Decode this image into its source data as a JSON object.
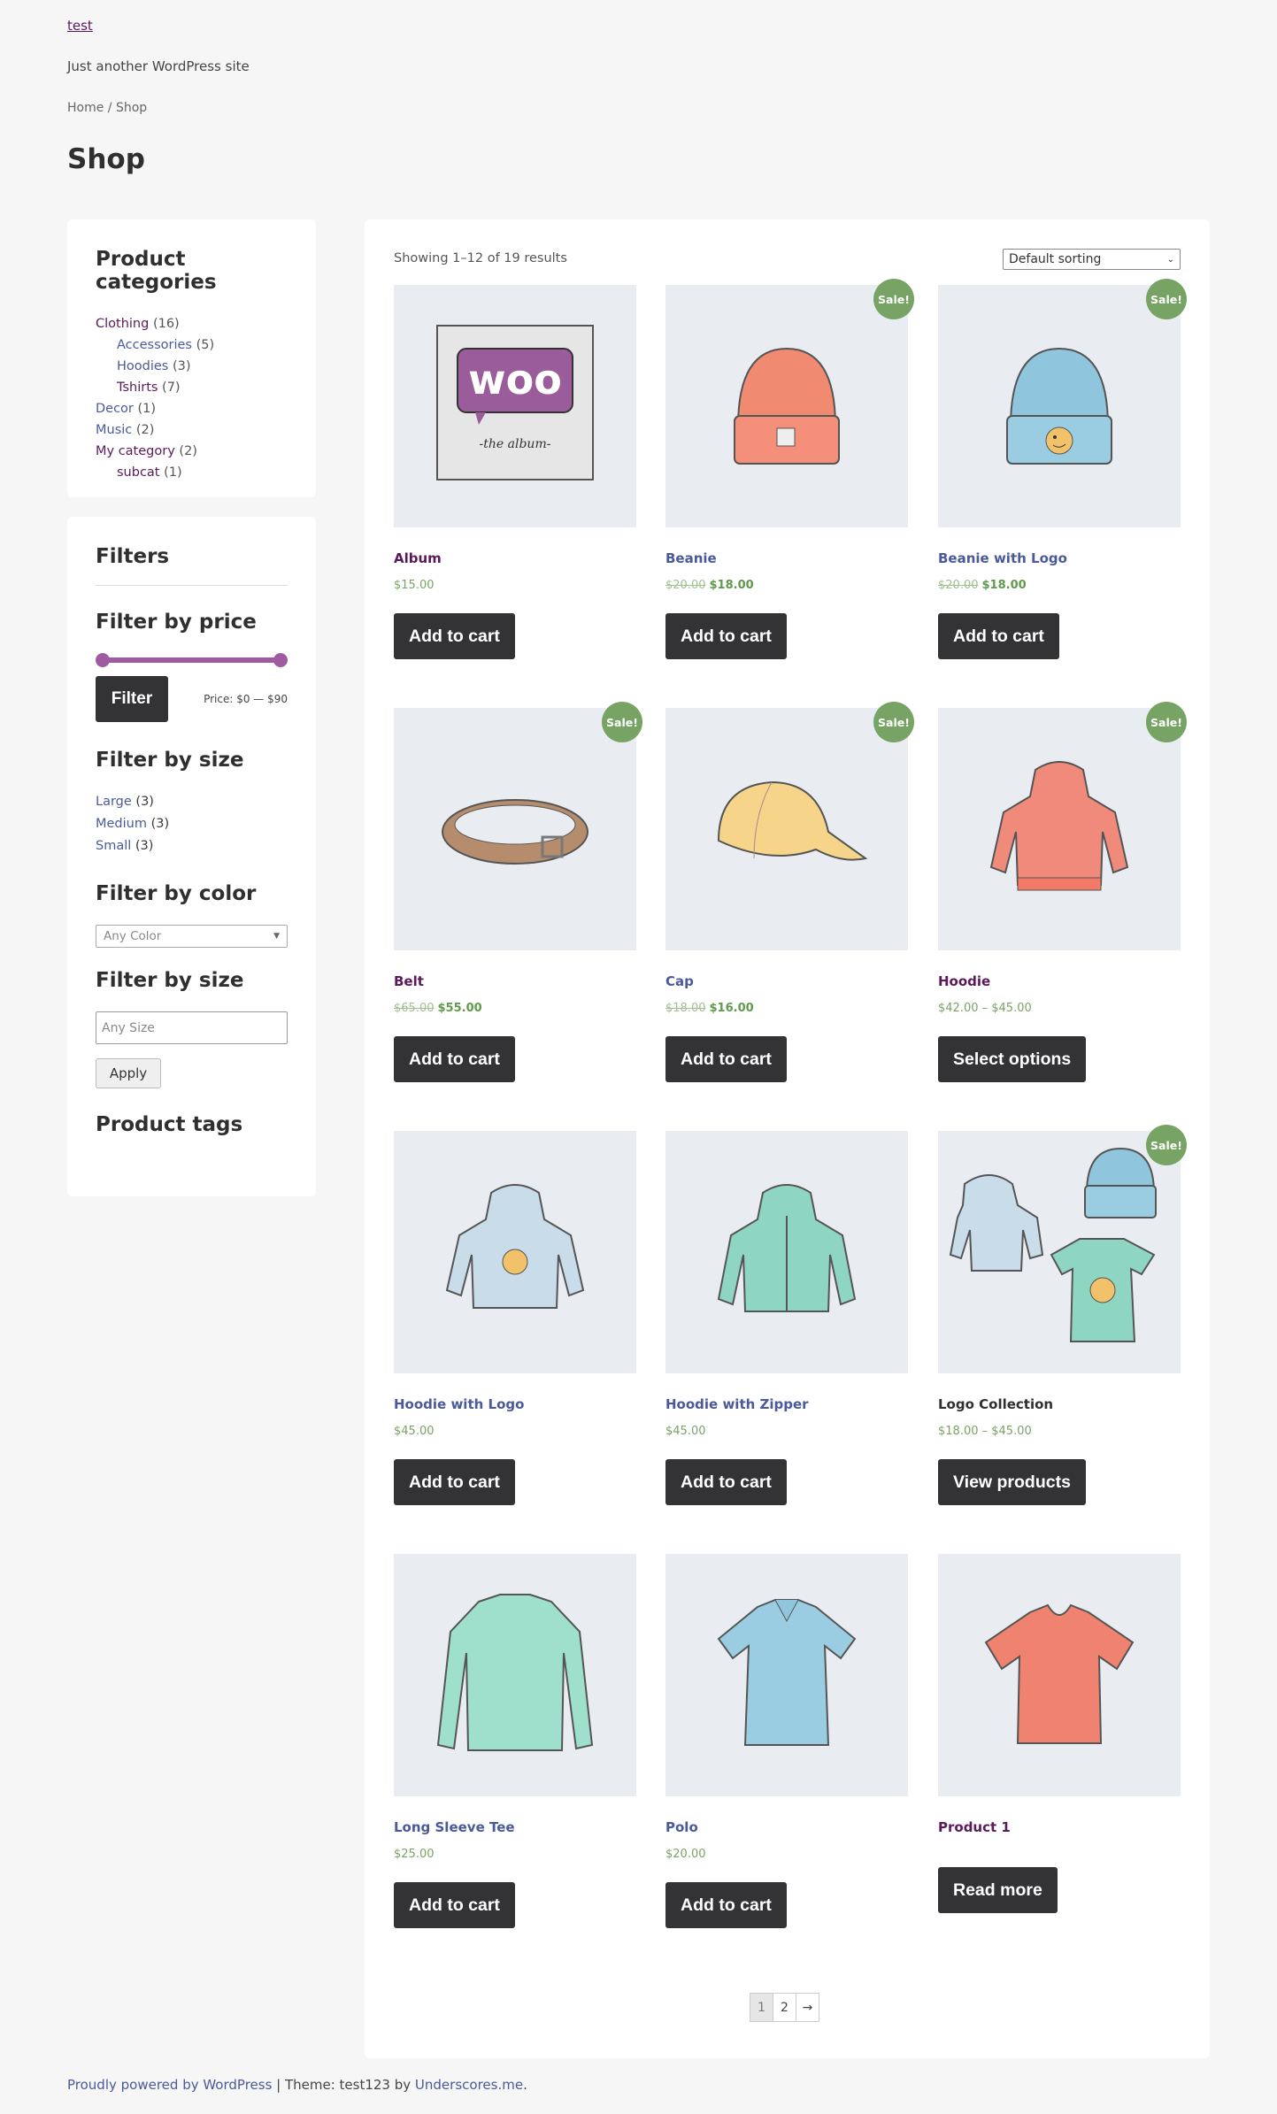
{
  "site": {
    "title": "test",
    "tagline": "Just another WordPress site"
  },
  "breadcrumb": {
    "home": "Home",
    "sep": " / ",
    "current": "Shop"
  },
  "page_title": "Shop",
  "categories": {
    "title": "Product categories",
    "items": [
      {
        "label": "Clothing",
        "count": "(16)"
      },
      {
        "label": "Accessories",
        "count": "(5)"
      },
      {
        "label": "Hoodies",
        "count": "(3)"
      },
      {
        "label": "Tshirts",
        "count": "(7)"
      },
      {
        "label": "Decor",
        "count": "(1)"
      },
      {
        "label": "Music",
        "count": "(2)"
      },
      {
        "label": "My category",
        "count": "(2)"
      },
      {
        "label": "subcat",
        "count": "(1)"
      }
    ]
  },
  "filters": {
    "title": "Filters",
    "price_title": "Filter by price",
    "filter_button": "Filter",
    "price_label": "Price: $0 — $90",
    "size_title": "Filter by size",
    "sizes": [
      {
        "label": "Large",
        "count": "(3)"
      },
      {
        "label": "Medium",
        "count": "(3)"
      },
      {
        "label": "Small",
        "count": "(3)"
      }
    ],
    "color_title": "Filter by color",
    "color_placeholder": "Any Color",
    "size_title_2": "Filter by size",
    "size_placeholder": "Any Size",
    "apply_button": "Apply",
    "tags_title": "Product tags"
  },
  "toolbar": {
    "result_count": "Showing 1–12 of 19 results",
    "sorting": "Default sorting"
  },
  "sale_badge": "Sale!",
  "products": [
    {
      "name": "Album",
      "price": "$15.00",
      "old_price": "",
      "new_price": "",
      "button": "Add to cart",
      "sale": false,
      "icon": "album-icon"
    },
    {
      "name": "Beanie",
      "price": "",
      "old_price": "$20.00",
      "new_price": "$18.00",
      "button": "Add to cart",
      "sale": true,
      "icon": "beanie-icon"
    },
    {
      "name": "Beanie with Logo",
      "price": "",
      "old_price": "$20.00",
      "new_price": "$18.00",
      "button": "Add to cart",
      "sale": true,
      "icon": "beanie-logo-icon"
    },
    {
      "name": "Belt",
      "price": "",
      "old_price": "$65.00",
      "new_price": "$55.00",
      "button": "Add to cart",
      "sale": true,
      "icon": "belt-icon"
    },
    {
      "name": "Cap",
      "price": "",
      "old_price": "$18.00",
      "new_price": "$16.00",
      "button": "Add to cart",
      "sale": true,
      "icon": "cap-icon"
    },
    {
      "name": "Hoodie",
      "price": "$42.00 – $45.00",
      "old_price": "",
      "new_price": "",
      "button": "Select options",
      "sale": true,
      "icon": "hoodie-icon"
    },
    {
      "name": "Hoodie with Logo",
      "price": "$45.00",
      "old_price": "",
      "new_price": "",
      "button": "Add to cart",
      "sale": false,
      "icon": "hoodie-logo-icon"
    },
    {
      "name": "Hoodie with Zipper",
      "price": "$45.00",
      "old_price": "",
      "new_price": "",
      "button": "Add to cart",
      "sale": false,
      "icon": "hoodie-zipper-icon"
    },
    {
      "name": "Logo Collection",
      "price": "$18.00 – $45.00",
      "old_price": "",
      "new_price": "",
      "button": "View products",
      "sale": true,
      "icon": "logo-collection-icon"
    },
    {
      "name": "Long Sleeve Tee",
      "price": "$25.00",
      "old_price": "",
      "new_price": "",
      "button": "Add to cart",
      "sale": false,
      "icon": "long-sleeve-tee-icon"
    },
    {
      "name": "Polo",
      "price": "$20.00",
      "old_price": "",
      "new_price": "",
      "button": "Add to cart",
      "sale": false,
      "icon": "polo-icon"
    },
    {
      "name": "Product 1",
      "price": "",
      "old_price": "",
      "new_price": "",
      "button": "Read more",
      "sale": false,
      "icon": "tshirt-icon"
    }
  ],
  "pagination": {
    "pages": [
      "1",
      "2"
    ],
    "next": "→",
    "current": "1"
  },
  "footer": {
    "powered": "Proudly powered by WordPress",
    "theme_text": " | Theme: test123 by ",
    "underscores": "Underscores.me",
    "end": "."
  },
  "colors": {
    "accent": "#a05aa0",
    "sale": "#77a464",
    "button": "#333335"
  }
}
